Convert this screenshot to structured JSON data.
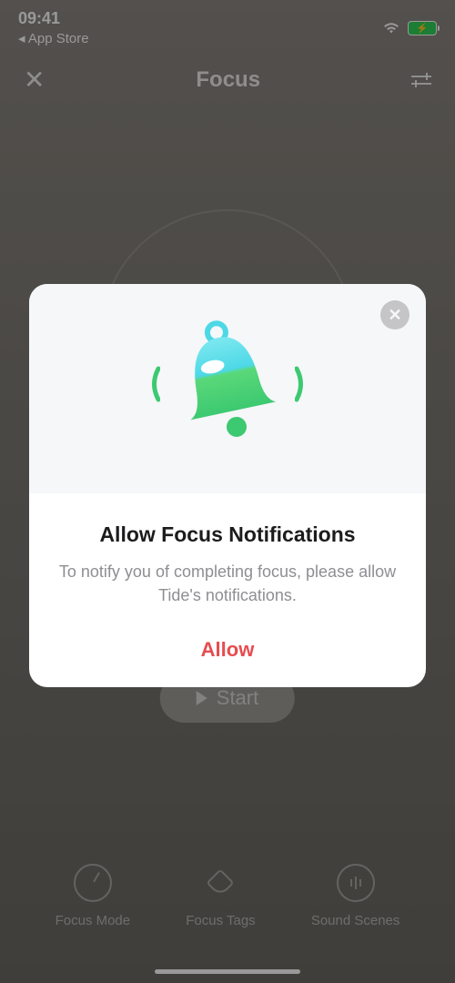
{
  "status": {
    "time": "09:41",
    "back_link": "◂ App Store"
  },
  "header": {
    "title": "Focus"
  },
  "main": {
    "start_label": "Start"
  },
  "nav": {
    "items": [
      {
        "label": "Focus Mode"
      },
      {
        "label": "Focus Tags"
      },
      {
        "label": "Sound Scenes"
      }
    ]
  },
  "modal": {
    "title": "Allow Focus Notifications",
    "description": "To notify you of completing focus, please allow Tide's notifications.",
    "allow_label": "Allow",
    "colors": {
      "accent": "#e74c50",
      "bell_top": "#4dd8e6",
      "bell_bottom": "#3cc971"
    }
  }
}
